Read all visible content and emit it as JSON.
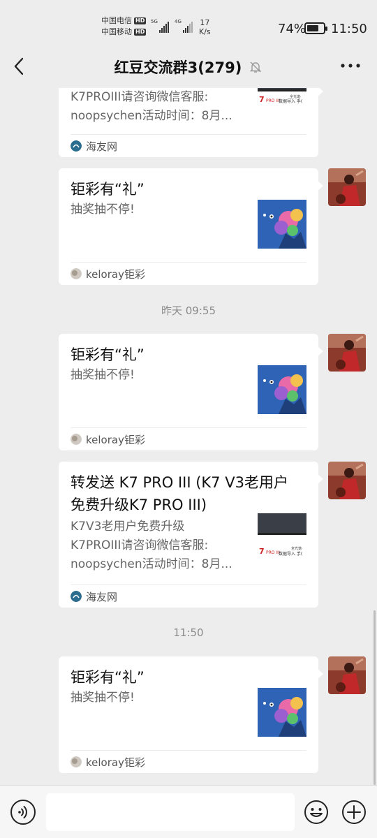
{
  "status_bar": {
    "carrier_1": "中国电信",
    "carrier_2": "中国移动",
    "hd_badge": "HD",
    "network_1": "5G",
    "network_2": "4G",
    "speed_value": "17",
    "speed_unit": "K/s",
    "battery_percent_text": "74%",
    "battery_level": 0.74,
    "time": "11:50"
  },
  "nav": {
    "back_icon": "chevron-left-icon",
    "title": "红豆交流群3(279)",
    "mute_icon": "bell-off-icon",
    "more_icon": "more-dots-icon"
  },
  "messages": {
    "card_1": {
      "desc_line_1": "K7PROIII请咨询微信客服:",
      "desc_line_2": "noopsychen活动时间：8月...",
      "source": "海友网"
    },
    "card_2": {
      "title": "钜彩有“礼”",
      "desc": "抽奖抽不停!",
      "source": "keloray钜彩"
    },
    "timestamp_1": "昨天 09:55",
    "card_3": {
      "title": "钜彩有“礼”",
      "desc": "抽奖抽不停!",
      "source": "keloray钜彩"
    },
    "card_4": {
      "title_line_1": "转发送 K7 PRO III (K7 V3老用户",
      "title_line_2": "免费升级K7 PRO III)",
      "desc_line_1": "K7V3老用户免费升级",
      "desc_line_2": "K7PROIII请咨询微信客服:",
      "desc_line_3": "noopsychen活动时间：8月...",
      "source": "海友网"
    },
    "timestamp_2": "11:50",
    "card_5": {
      "title": "钜彩有“礼”",
      "desc": "抽奖抽不停!",
      "source": "keloray钜彩"
    }
  },
  "thumb_text": {
    "k7_small": "7",
    "k7_pro": "PRO III",
    "caption_1": "全光谱·",
    "caption_2": "数据导入 手(",
    "caption_3": "全光谱·",
    "caption_4": "数据导入 手("
  },
  "input_bar": {
    "voice_icon": "voice-icon",
    "emoji_icon": "smiley-icon",
    "plus_icon": "plus-circle-icon",
    "placeholder": ""
  },
  "colors": {
    "background": "#ededed",
    "bubble": "#ffffff",
    "text_secondary": "#666666",
    "timestamp": "#8a8a8a"
  }
}
